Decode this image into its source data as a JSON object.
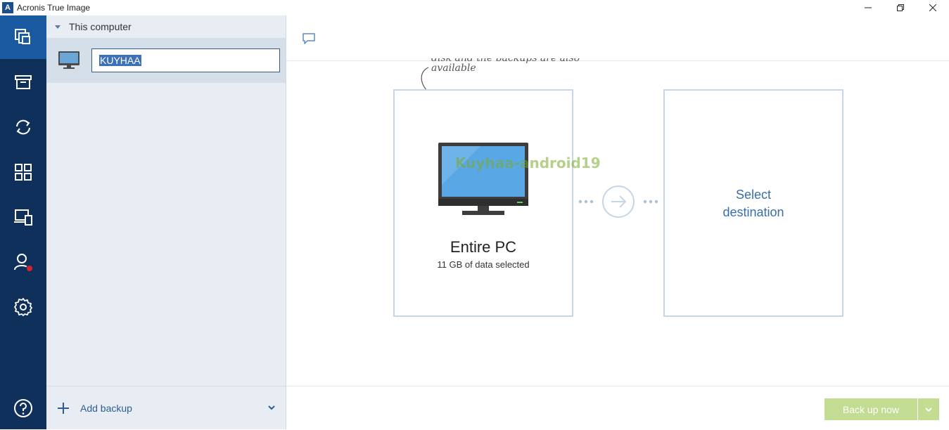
{
  "window": {
    "title": "Acronis True Image",
    "logo_letter": "A"
  },
  "sidebar": {
    "group_label": "This computer",
    "backup_name": "KUYHAA",
    "add_backup_label": "Add backup"
  },
  "main": {
    "hint_line1": "disk and the backups are also",
    "hint_line2": "available",
    "source": {
      "title": "Entire PC",
      "subtitle": "11 GB of data selected"
    },
    "destination": {
      "line1": "Select",
      "line2": "destination"
    },
    "watermark": "Kuyhaa-android19",
    "back_up_label": "Back up now"
  },
  "nav": {
    "items": [
      "backup-icon",
      "archive-icon",
      "sync-icon",
      "dashboard-icon",
      "tools-icon",
      "account-icon",
      "settings-icon",
      "help-icon"
    ]
  },
  "colors": {
    "nav_bg": "#10305c",
    "nav_active": "#1a5aa0",
    "sidebar_bg": "#e8edf3",
    "accent": "#3a6ea8",
    "button": "#c2dc91",
    "alert": "#d9232d"
  }
}
